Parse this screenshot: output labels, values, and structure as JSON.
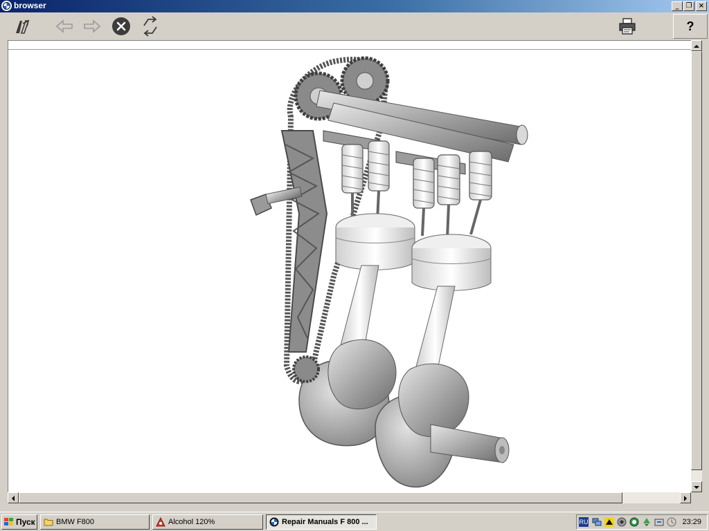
{
  "window": {
    "title": "browser"
  },
  "toolbar": {
    "help_label": "?"
  },
  "taskbar": {
    "start_label": "Пуск",
    "tasks": [
      {
        "label": "BMW F800"
      },
      {
        "label": "Alcohol 120%"
      },
      {
        "label": "Repair Manuals F 800 ..."
      }
    ],
    "tray": {
      "language": "RU",
      "clock": "23:29"
    }
  }
}
